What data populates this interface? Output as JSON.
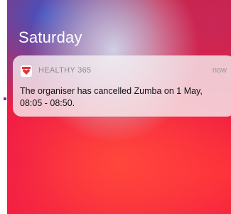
{
  "lockscreen": {
    "day": "Saturday"
  },
  "notification": {
    "app_icon": "heart-app-icon",
    "app_name": "HEALTHY 365",
    "time": "now",
    "message": "The organiser has cancelled Zumba on 1 May, 08:05 - 08:50."
  },
  "colors": {
    "wallpaper_red": "#ee1e44",
    "wallpaper_blue": "#3c55c8",
    "app_icon_red": "#e0343c"
  }
}
